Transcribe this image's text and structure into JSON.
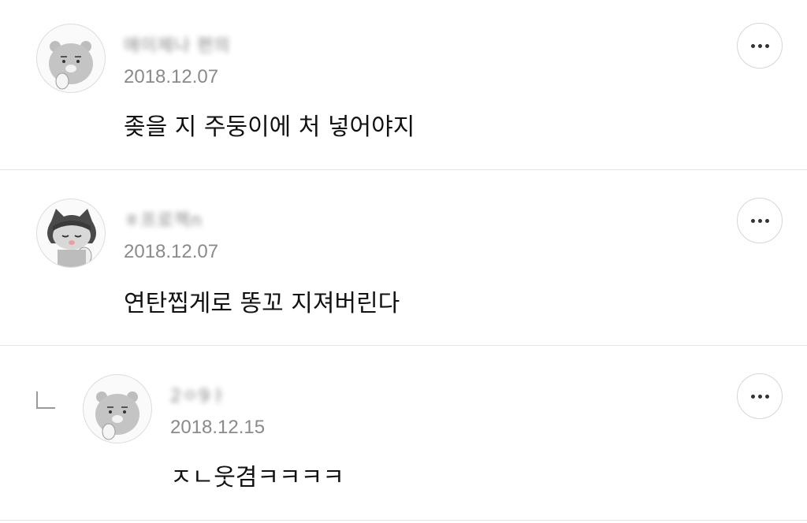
{
  "comments": [
    {
      "author": "애이제나 편의",
      "date": "2018.12.07",
      "text": "좆을 지 주둥이에 처 넣어야지",
      "avatar_icon": "ryan-avatar-icon",
      "more_icon": "more-icon"
    },
    {
      "author": "ㅎ프로젝n",
      "date": "2018.12.07",
      "text": "연탄찝게로 똥꼬 지져버린다",
      "avatar_icon": "cat-avatar-icon",
      "more_icon": "more-icon"
    },
    {
      "author": "2ㅇ9ㅏ",
      "date": "2018.12.15",
      "text": "ㅈㄴ웃겸ㅋㅋㅋㅋ",
      "avatar_icon": "ryan-avatar-icon",
      "more_icon": "more-icon",
      "is_reply": true
    }
  ],
  "colors": {
    "divider": "#e3e3e3",
    "date": "#8a8a8a",
    "text": "#111111"
  }
}
